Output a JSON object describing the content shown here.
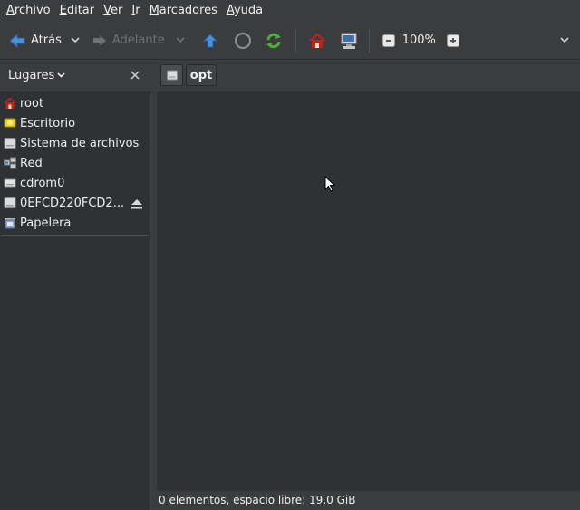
{
  "menubar": {
    "items": [
      {
        "mnemonic": "A",
        "rest": "rchivo"
      },
      {
        "mnemonic": "E",
        "rest": "ditar"
      },
      {
        "mnemonic": "V",
        "rest": "er"
      },
      {
        "mnemonic": "I",
        "rest": "r"
      },
      {
        "mnemonic": "M",
        "rest": "arcadores"
      },
      {
        "mnemonic": "A",
        "rest": "yuda"
      }
    ]
  },
  "toolbar": {
    "back_label": "Atrás",
    "forward_label": "Adelante",
    "zoom_level": "100%"
  },
  "sidepane": {
    "header_label": "Lugares",
    "places": [
      {
        "label": "root",
        "icon": "home-icon"
      },
      {
        "label": "Escritorio",
        "icon": "desktop-icon"
      },
      {
        "label": "Sistema de archivos",
        "icon": "drive-icon"
      },
      {
        "label": "Red",
        "icon": "network-icon"
      },
      {
        "label": "cdrom0",
        "icon": "cdrom-icon"
      },
      {
        "label": "0EFCD220FCD2...",
        "icon": "drive-icon"
      },
      {
        "label": "Papelera",
        "icon": "trash-icon"
      }
    ]
  },
  "pathbar": {
    "current": "opt"
  },
  "statusbar": {
    "text": "0 elementos, espacio libre: 19.0 GiB"
  },
  "colors": {
    "background": "#2e3234",
    "chrome": "#3a3c3e",
    "text": "#eeeeec",
    "disabled_text": "#6f7173",
    "accent_blue": "#4a8fd9",
    "accent_green": "#4caf3a",
    "home_red": "#c4201b"
  }
}
